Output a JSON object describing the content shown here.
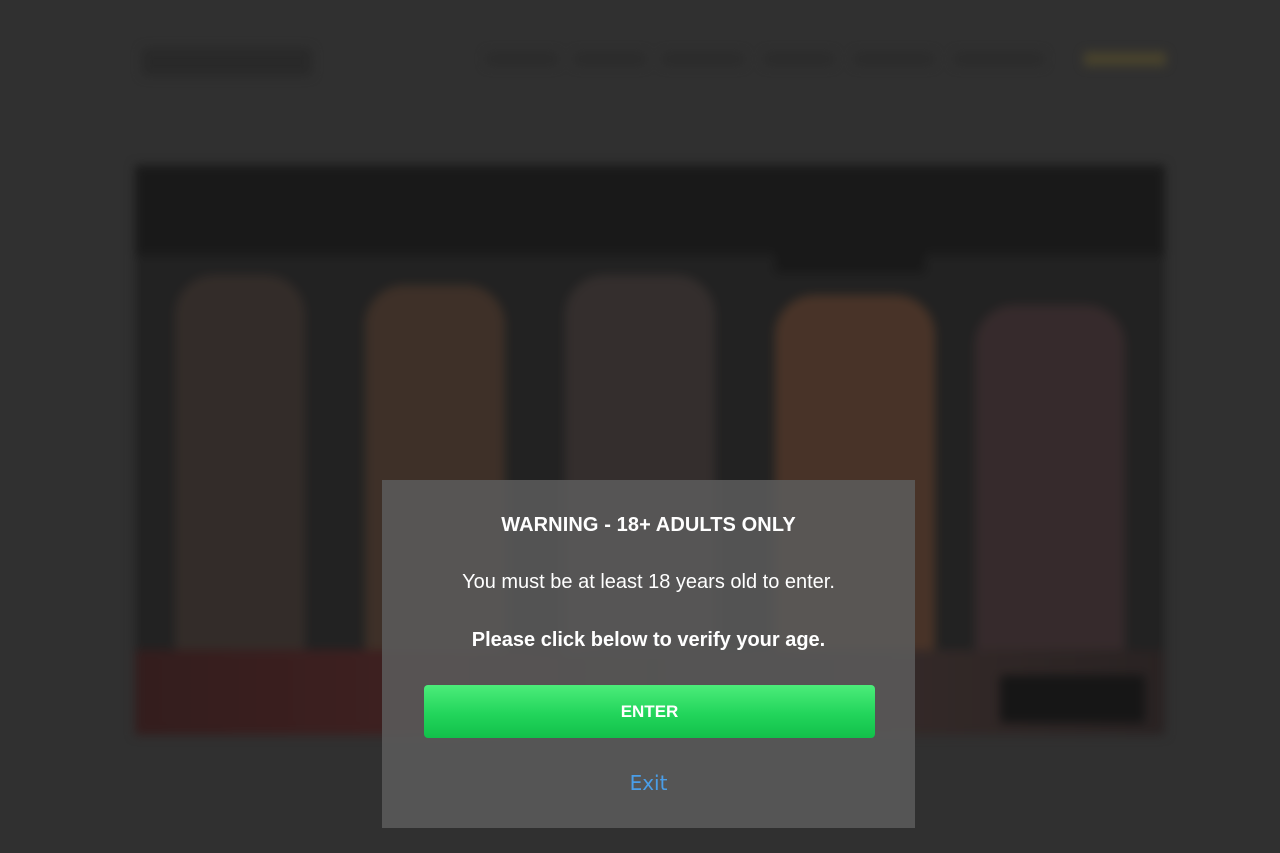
{
  "modal": {
    "title": "WARNING - 18+ ADULTS ONLY",
    "message": "You must be at least 18 years old to enter.",
    "verify_prompt": "Please click below to verify your age.",
    "enter_label": "ENTER",
    "exit_label": "Exit"
  },
  "colors": {
    "enter_button": "#22d55b",
    "exit_link": "#4a9ee8",
    "modal_background": "#5c5c5c",
    "page_background": "#353535"
  }
}
